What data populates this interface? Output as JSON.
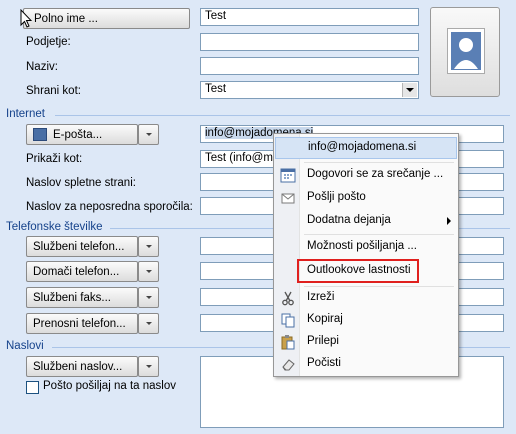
{
  "name_section": {
    "full_name_button": "Polno ime ...",
    "full_name_value": "Test",
    "department_label": "Podjetje:",
    "title_label": "Naziv:",
    "file_as_label": "Shrani kot:",
    "file_as_value": "Test"
  },
  "internet": {
    "section_label": "Internet",
    "email_button": "E-pošta...",
    "email_value": "info@mojadomena.si",
    "display_as_label": "Prikaži kot:",
    "display_as_value": "Test (info@mo",
    "web_label": "Naslov spletne strani:",
    "im_label": "Naslov za neposredna sporočila:"
  },
  "phones": {
    "section_label": "Telefonske številke",
    "buttons": [
      "Službeni telefon...",
      "Domači telefon...",
      "Službeni faks...",
      "Prenosni telefon..."
    ]
  },
  "addresses": {
    "section_label": "Naslovi",
    "address_button": "Službeni naslov...",
    "mailing_checkbox_label": "Pošto pošiljaj na ta naslov"
  },
  "context_menu": {
    "header": "info@mojadomena.si",
    "items": [
      "Dogovori se za srečanje ...",
      "Pošlji pošto",
      "Dodatna dejanja",
      "Možnosti pošiljanja ...",
      "Outlookove lastnosti",
      "Izreži",
      "Kopiraj",
      "Prilepi",
      "Počisti"
    ],
    "highlight_color": "#e0201e"
  }
}
